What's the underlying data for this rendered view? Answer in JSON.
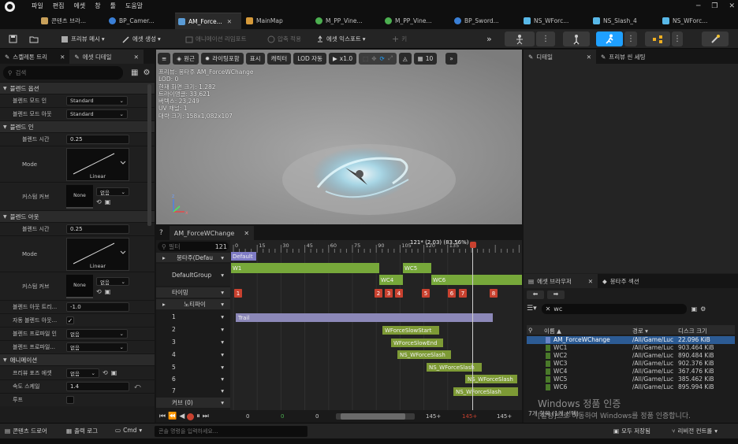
{
  "menu": [
    "파일",
    "편집",
    "에셋",
    "창",
    "툴",
    "도움말"
  ],
  "window_controls": [
    "─",
    "❐",
    "✕"
  ],
  "tabs": [
    {
      "label": "콘텐츠 브라...",
      "icon": "folder-icon",
      "color": "#c8a05a"
    },
    {
      "label": "BP_Camer...",
      "icon": "blueprint-icon",
      "color": "#3a7fd6"
    },
    {
      "label": "AM_Force...",
      "icon": "anim-montage-icon",
      "color": "#5a9bd6",
      "active": true
    },
    {
      "label": "MainMap",
      "icon": "level-icon",
      "color": "#d69a3a"
    },
    {
      "label": "M_PP_Vine...",
      "icon": "material-icon",
      "color": "#4caf50"
    },
    {
      "label": "M_PP_Vine...",
      "icon": "material-icon",
      "color": "#4caf50"
    },
    {
      "label": "BP_Sword...",
      "icon": "blueprint-icon",
      "color": "#3a7fd6"
    },
    {
      "label": "NS_WForc...",
      "icon": "niagara-icon",
      "color": "#58b8e8"
    },
    {
      "label": "NS_Slash_4",
      "icon": "niagara-icon",
      "color": "#58b8e8"
    },
    {
      "label": "NS_WForc...",
      "icon": "niagara-icon",
      "color": "#58b8e8"
    }
  ],
  "toolbar": {
    "browse_menu": "프리뷰 메시",
    "create_asset": "에셋 생성",
    "apply_anim": "애니메이션 리임포트",
    "apply_compress": "압축 적용",
    "asset_export": "에셋 익스포트",
    "add_key": "키"
  },
  "left": {
    "tab1": "스켈레톤 트리",
    "tab2": "에셋 디테일",
    "search_placeholder": "검색",
    "blend_options": "블렌드 옵션",
    "blend_mode_in": "블렌드 모드 인",
    "blend_mode_in_val": "Standard",
    "blend_mode_out": "블렌드 모드 아웃",
    "blend_mode_out_val": "Standard",
    "blend_in": "블렌드 인",
    "blend_time": "블렌드 시간",
    "blend_in_time": "0.25",
    "mode": "Mode",
    "linear": "Linear",
    "custom_curve": "커스텀 커브",
    "none": "None",
    "none_dd": "없음",
    "blend_out": "블렌드 아웃",
    "blend_out_time": "0.25",
    "blend_out_trigger": "블렌드 아웃 트리...",
    "blend_out_trigger_val": "-1.0",
    "auto_blend_out": "자동 블렌드 아웃...",
    "blend_profile_in": "블렌드 프로파일 인",
    "blend_profile_in_val": "없음",
    "blend_profile_out": "블렌드 프로파일...",
    "blend_profile_out_val": "없음",
    "animation": "애니메이션",
    "preview_pose": "프리뷰 포즈 에셋",
    "preview_pose_val": "없음",
    "rate_scale": "속도 스케일",
    "rate_scale_val": "1.4",
    "loop": "루프"
  },
  "viewport": {
    "perspective": "원근",
    "lit": "라이팅포함",
    "show": "표시",
    "character": "캐릭터",
    "lod": "LOD 자동",
    "speed": "x1.0",
    "grid_num": "10",
    "stats": [
      "프리뷰: 몽타주 AM_ForceWChange",
      "LOD: 0",
      "현재 화면 크기: 1.282",
      "트라이앵글: 33,621",
      "버텍스: 23,249",
      "UV 채널: 1",
      "대략 크기: 158x1,082x107"
    ]
  },
  "timeline": {
    "tab_label": "AM_ForceWChange",
    "filter_placeholder": "필터",
    "frame_count": "121",
    "playhead_label": "121* (2.03) (83.56%)",
    "ruler_ticks": [
      "0",
      "15",
      "30",
      "45",
      "60",
      "75",
      "90",
      "105",
      "120",
      "135"
    ],
    "tracks": {
      "montage": "몽타주(Defau",
      "default_group": "DefaultGroup",
      "timing": "타이밍",
      "notifies": "노티파이",
      "n1": "1",
      "n2": "2",
      "n3": "3",
      "n4": "4",
      "n5": "5",
      "n6": "6",
      "n7": "7",
      "curves": "커브",
      "curves_count": "(0)"
    },
    "default_section": "Default",
    "segments": [
      "W1",
      "WC5",
      "WC4",
      "WC6"
    ],
    "timing_markers": [
      "1",
      "2",
      "3",
      "4",
      "5",
      "6",
      "7",
      "8"
    ],
    "notifies": [
      "Trail",
      "WForceSlowStart",
      "WForceSlowEnd",
      "NS_WForceSlash",
      "NS_WForceSlash",
      "NS_WForceSlash",
      "NS_WForceSlash"
    ],
    "transport": {
      "start": "0",
      "mid": "0",
      "cur": "0",
      "end1": "145+",
      "end2": "145+",
      "end3": "145+"
    }
  },
  "right": {
    "details_tab": "디테일",
    "preview_settings_tab": "프리뷰 씬 세팅",
    "asset_browser_tab": "에셋 브라우저",
    "montage_sections_tab": "몽타주 섹션",
    "search_value": "wc",
    "columns": [
      "이름 ▲",
      "경로 ▾",
      "디스크 크기"
    ],
    "assets": [
      {
        "name": "AM_ForceWChange",
        "path": "/All/Game/Luc",
        "size": "22.096 KiB",
        "selected": true
      },
      {
        "name": "WC1",
        "path": "/All/Game/Luc",
        "size": "903.464 KiB"
      },
      {
        "name": "WC2",
        "path": "/All/Game/Luc",
        "size": "890.484 KiB"
      },
      {
        "name": "WC3",
        "path": "/All/Game/Luc",
        "size": "902.376 KiB"
      },
      {
        "name": "WC4",
        "path": "/All/Game/Luc",
        "size": "367.476 KiB"
      },
      {
        "name": "WC5",
        "path": "/All/Game/Luc",
        "size": "385.462 KiB"
      },
      {
        "name": "WC6",
        "path": "/All/Game/Luc",
        "size": "895.994 KiB"
      }
    ],
    "item_count": "7개 항목 (1개 선택)",
    "watermark_title": "Windows 정품 인증",
    "watermark_sub": "[설정]으로 이동하여 Windows를 정품 인증합니다."
  },
  "bottom": {
    "content_drawer": "콘텐츠 드로어",
    "output_log": "출력 로그",
    "cmd": "Cmd",
    "console_placeholder": "콘솔 명령을 입력하세요...",
    "save_all": "모두 저장됨",
    "revision": "리비전 컨트롤"
  }
}
